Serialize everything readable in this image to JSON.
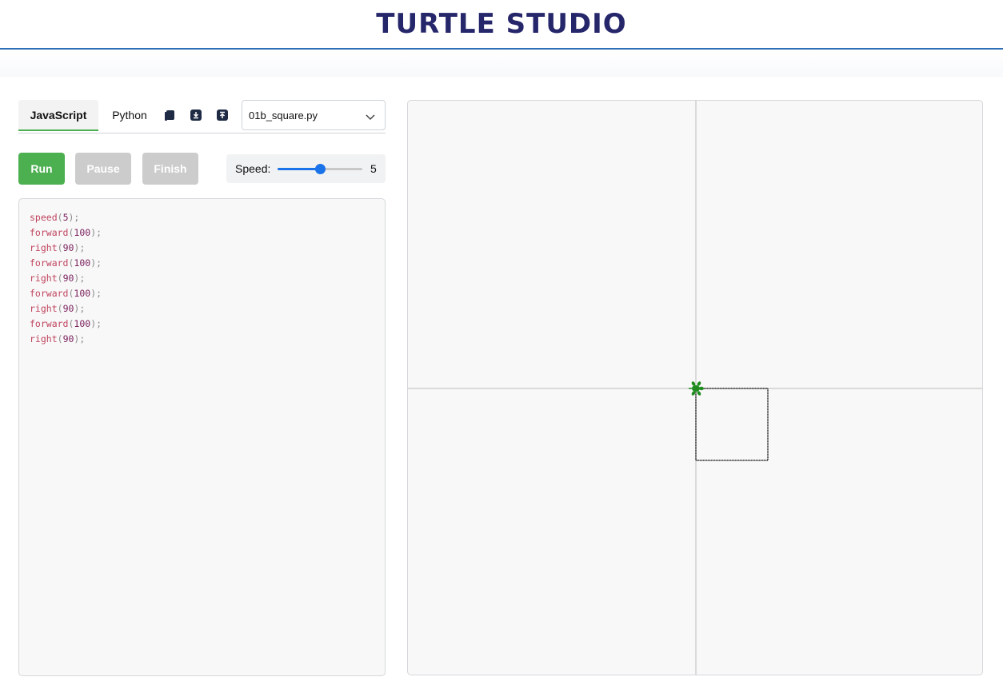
{
  "header": {
    "title": "TURTLE STUDIO"
  },
  "tabs": [
    {
      "label": "JavaScript",
      "active": true
    },
    {
      "label": "Python",
      "active": false
    }
  ],
  "toolbar_icons": [
    "copy-icon",
    "download-icon",
    "upload-icon"
  ],
  "file_select": {
    "value": "01b_square.py"
  },
  "buttons": {
    "run": "Run",
    "pause": "Pause",
    "finish": "Finish"
  },
  "speed": {
    "label": "Speed:",
    "value": "5",
    "level_fraction": 0.5
  },
  "code": [
    {
      "fn": "speed",
      "arg": "5"
    },
    {
      "fn": "forward",
      "arg": "100"
    },
    {
      "fn": "right",
      "arg": "90"
    },
    {
      "fn": "forward",
      "arg": "100"
    },
    {
      "fn": "right",
      "arg": "90"
    },
    {
      "fn": "forward",
      "arg": "100"
    },
    {
      "fn": "right",
      "arg": "90"
    },
    {
      "fn": "forward",
      "arg": "100"
    },
    {
      "fn": "right",
      "arg": "90"
    }
  ],
  "colors": {
    "accent": "#4caf50",
    "title": "#26266b",
    "slider": "#1a73e8",
    "turtle": "#1e8c1e",
    "path": "#333333"
  }
}
